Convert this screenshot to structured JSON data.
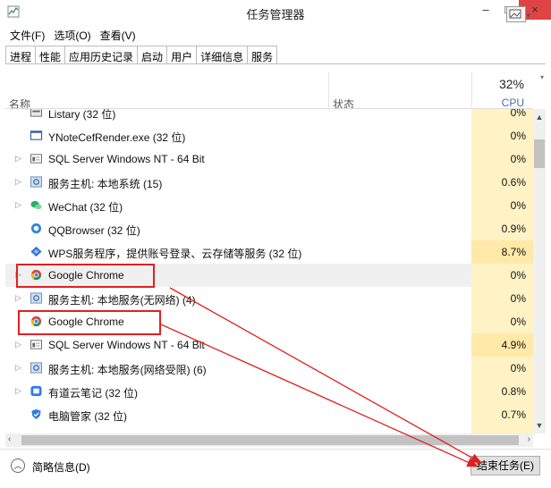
{
  "window": {
    "title": "任务管理器",
    "minimize": "–",
    "maximize": "□",
    "close": "×"
  },
  "menu": [
    "文件(F)",
    "选项(O)",
    "查看(V)"
  ],
  "tabs": [
    "进程",
    "性能",
    "应用历史记录",
    "启动",
    "用户",
    "详细信息",
    "服务"
  ],
  "header": {
    "cpu_percent": "32%",
    "name": "名称",
    "status": "状态",
    "cpu": "CPU"
  },
  "rows": [
    {
      "name": "Listary (32 位)",
      "cpu": "0%",
      "expand": false,
      "icon": "listary-icon"
    },
    {
      "name": "YNoteCefRender.exe (32 位)",
      "cpu": "0%",
      "expand": false,
      "icon": "window-icon"
    },
    {
      "name": "SQL Server Windows NT - 64 Bit",
      "cpu": "0%",
      "expand": true,
      "icon": "sql-server-icon"
    },
    {
      "name": "服务主机: 本地系统 (15)",
      "cpu": "0.6%",
      "expand": true,
      "icon": "service-host-icon"
    },
    {
      "name": "WeChat (32 位)",
      "cpu": "0%",
      "expand": true,
      "icon": "wechat-icon"
    },
    {
      "name": "QQBrowser (32 位)",
      "cpu": "0.9%",
      "expand": false,
      "icon": "qqbrowser-icon"
    },
    {
      "name": "WPS服务程序，提供账号登录、云存储等服务 (32 位)",
      "cpu": "8.7%",
      "expand": false,
      "icon": "wps-icon"
    },
    {
      "name": "Google Chrome",
      "cpu": "0%",
      "expand": true,
      "icon": "chrome-icon",
      "selected": true
    },
    {
      "name": "服务主机: 本地服务(无网络) (4)",
      "cpu": "0%",
      "expand": true,
      "icon": "service-host-icon"
    },
    {
      "name": "Google Chrome",
      "cpu": "0%",
      "expand": false,
      "icon": "chrome-icon"
    },
    {
      "name": "SQL Server Windows NT - 64 Bit",
      "cpu": "4.9%",
      "expand": true,
      "icon": "sql-server-icon"
    },
    {
      "name": "服务主机: 本地服务(网络受限) (6)",
      "cpu": "0%",
      "expand": true,
      "icon": "service-host-icon"
    },
    {
      "name": "有道云笔记 (32 位)",
      "cpu": "0.8%",
      "expand": true,
      "icon": "youdao-note-icon"
    },
    {
      "name": "电脑管家 (32 位)",
      "cpu": "0.7%",
      "expand": false,
      "icon": "pc-manager-icon"
    }
  ],
  "footer": {
    "fewer_details": "简略信息(D)",
    "end_task": "结束任务(E)"
  },
  "colors": {
    "cpu_low": "#fff3c6",
    "cpu_mid": "#ffe9a8",
    "annotation": "#e02020",
    "close_button": "#e04343"
  }
}
